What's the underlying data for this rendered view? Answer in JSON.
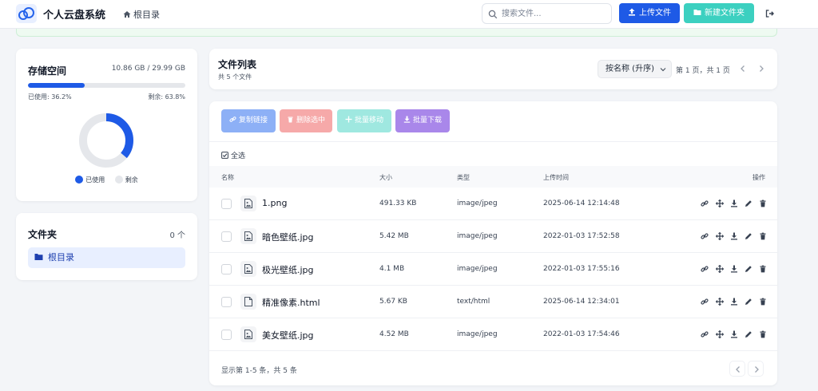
{
  "app": {
    "title": "个人云盘系统"
  },
  "header": {
    "breadcrumb": "根目录",
    "search_placeholder": "搜索文件...",
    "upload_label": "上传文件",
    "new_folder_label": "新建文件夹"
  },
  "storage": {
    "title": "存储空间",
    "amount": "10.86 GB / 29.99 GB",
    "used_fraction": 0.362,
    "used_label": "已使用: 36.2%",
    "remaining_label": "剩余: 63.8%",
    "legend_used": "已使用",
    "legend_remaining": "剩余"
  },
  "folders": {
    "title": "文件夹",
    "count": "0 个",
    "items": [
      {
        "label": "根目录"
      }
    ]
  },
  "list_header": {
    "title": "文件列表",
    "subtitle": "共 5 个文件",
    "sort_value": "按名称 (升序)",
    "page_info": "第 1 页，共 1 页"
  },
  "toolbar": {
    "copy_link": "复制链接",
    "delete_selected": "删除选中",
    "batch_move": "批量移动",
    "batch_download": "批量下载",
    "select_all": "全选"
  },
  "table": {
    "columns": [
      "名称",
      "大小",
      "类型",
      "上传时间",
      "操作"
    ],
    "rows": [
      {
        "name": "1.png",
        "size": "491.33 KB",
        "type": "image/jpeg",
        "time": "2025-06-14 12:14:48",
        "icon": "image-file-icon"
      },
      {
        "name": "暗色壁纸.jpg",
        "size": "5.42 MB",
        "type": "image/jpeg",
        "time": "2022-01-03 17:52:58",
        "icon": "image-file-icon"
      },
      {
        "name": "极光壁纸.jpg",
        "size": "4.1 MB",
        "type": "image/jpeg",
        "time": "2022-01-03 17:55:16",
        "icon": "image-file-icon"
      },
      {
        "name": "精准像素.html",
        "size": "5.67 KB",
        "type": "text/html",
        "time": "2025-06-14 12:34:01",
        "icon": "document-file-icon"
      },
      {
        "name": "美女壁纸.jpg",
        "size": "4.52 MB",
        "type": "image/jpeg",
        "time": "2022-01-03 17:54:46",
        "icon": "image-file-icon"
      }
    ]
  },
  "footer": {
    "summary": "显示第 1-5 条，共 5 条"
  },
  "colors": {
    "primary": "#1e5ae6",
    "teal": "#3cd0c0",
    "ring_track": "#e5e7eb"
  }
}
